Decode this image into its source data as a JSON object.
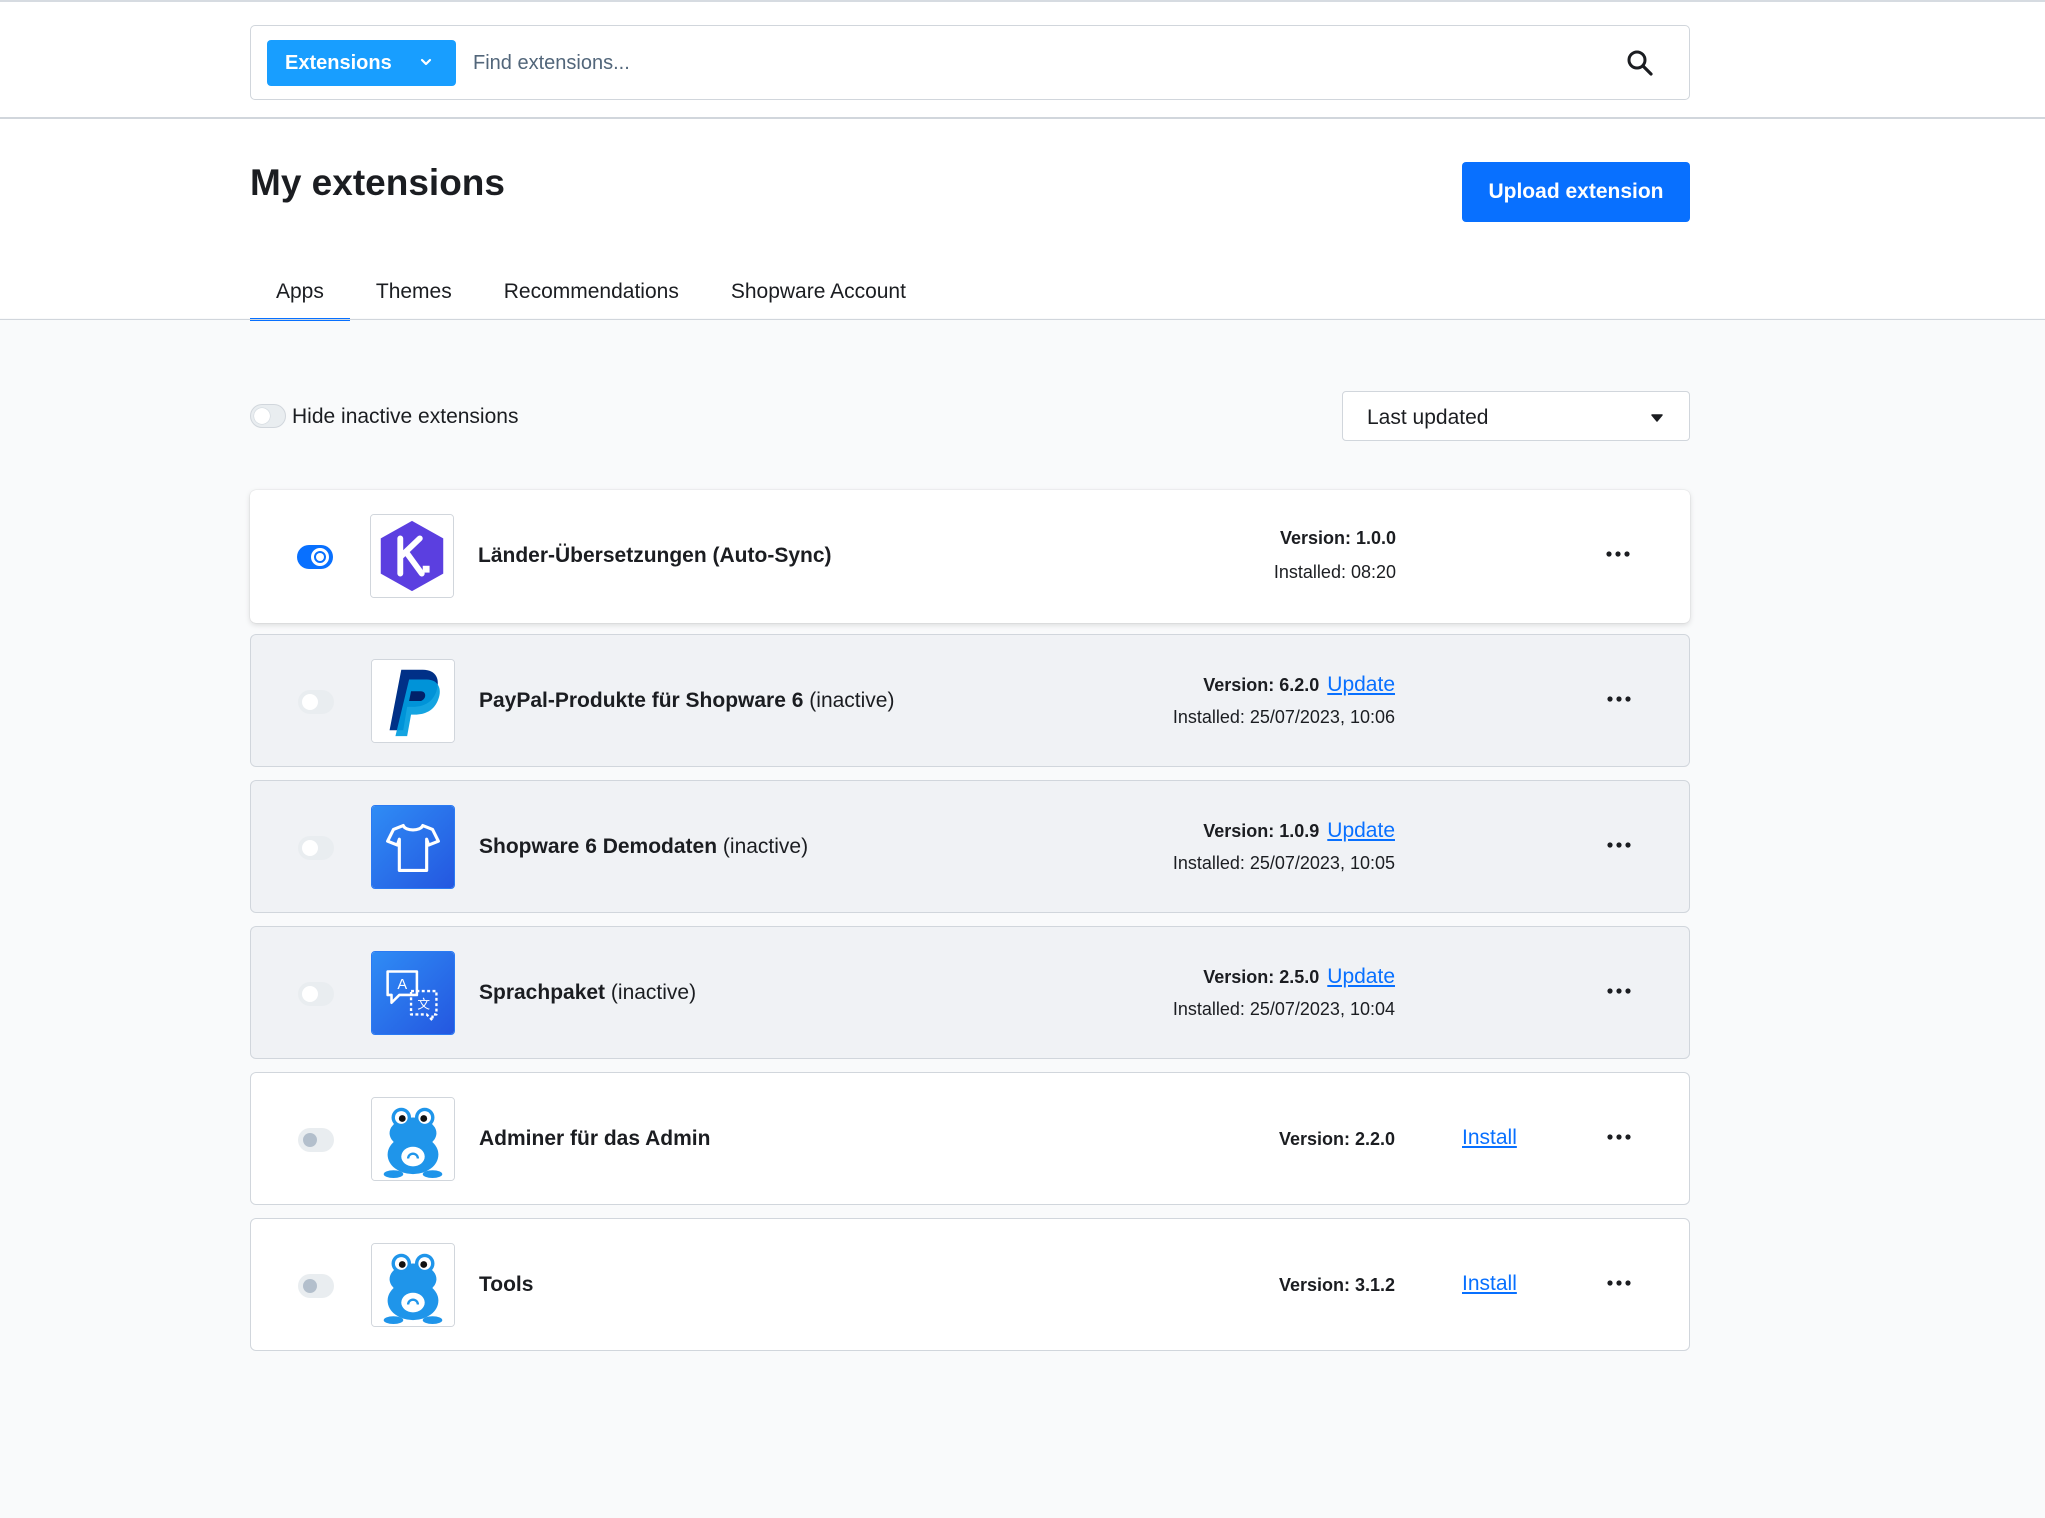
{
  "search": {
    "dropdown_label": "Extensions",
    "placeholder": "Find extensions..."
  },
  "page": {
    "title": "My extensions",
    "upload_label": "Upload extension"
  },
  "tabs": [
    {
      "label": "Apps",
      "active": true
    },
    {
      "label": "Themes",
      "active": false
    },
    {
      "label": "Recommendations",
      "active": false
    },
    {
      "label": "Shopware Account",
      "active": false
    }
  ],
  "toolbar": {
    "hide_inactive_label": "Hide inactive extensions",
    "sort_value": "Last updated"
  },
  "extensions": [
    {
      "name": "Länder-Übersetzungen (Auto-Sync)",
      "suffix": "",
      "version": "Version: 1.0.0",
      "installed": "Installed: 08:20",
      "active": true,
      "icon": "k-hexagon-icon",
      "action": ""
    },
    {
      "name": "PayPal-Produkte für Shopware 6",
      "suffix": "(inactive)",
      "version": "Version: 6.2.0",
      "update": "Update",
      "installed": "Installed: 25/07/2023, 10:06",
      "active": false,
      "icon": "paypal-icon",
      "action": ""
    },
    {
      "name": "Shopware 6 Demodaten",
      "suffix": "(inactive)",
      "version": "Version: 1.0.9",
      "update": "Update",
      "installed": "Installed: 25/07/2023, 10:05",
      "active": false,
      "icon": "tshirt-icon",
      "action": ""
    },
    {
      "name": "Sprachpaket",
      "suffix": "(inactive)",
      "version": "Version: 2.5.0",
      "update": "Update",
      "installed": "Installed: 25/07/2023, 10:04",
      "active": false,
      "icon": "translate-icon",
      "action": ""
    },
    {
      "name": "Adminer für das Admin",
      "suffix": "",
      "version": "Version: 2.2.0",
      "installed": "",
      "active": false,
      "icon": "frog-icon",
      "action": "Install"
    },
    {
      "name": "Tools",
      "suffix": "",
      "version": "Version: 3.1.2",
      "installed": "",
      "active": false,
      "icon": "frog-icon",
      "action": "Install"
    }
  ],
  "colors": {
    "accent": "#0870ff",
    "dropdown": "#189eff",
    "hex_purple": "#5b3fe0",
    "shopware_blue": "#2b7bf3",
    "frog_blue": "#1f95ea"
  }
}
